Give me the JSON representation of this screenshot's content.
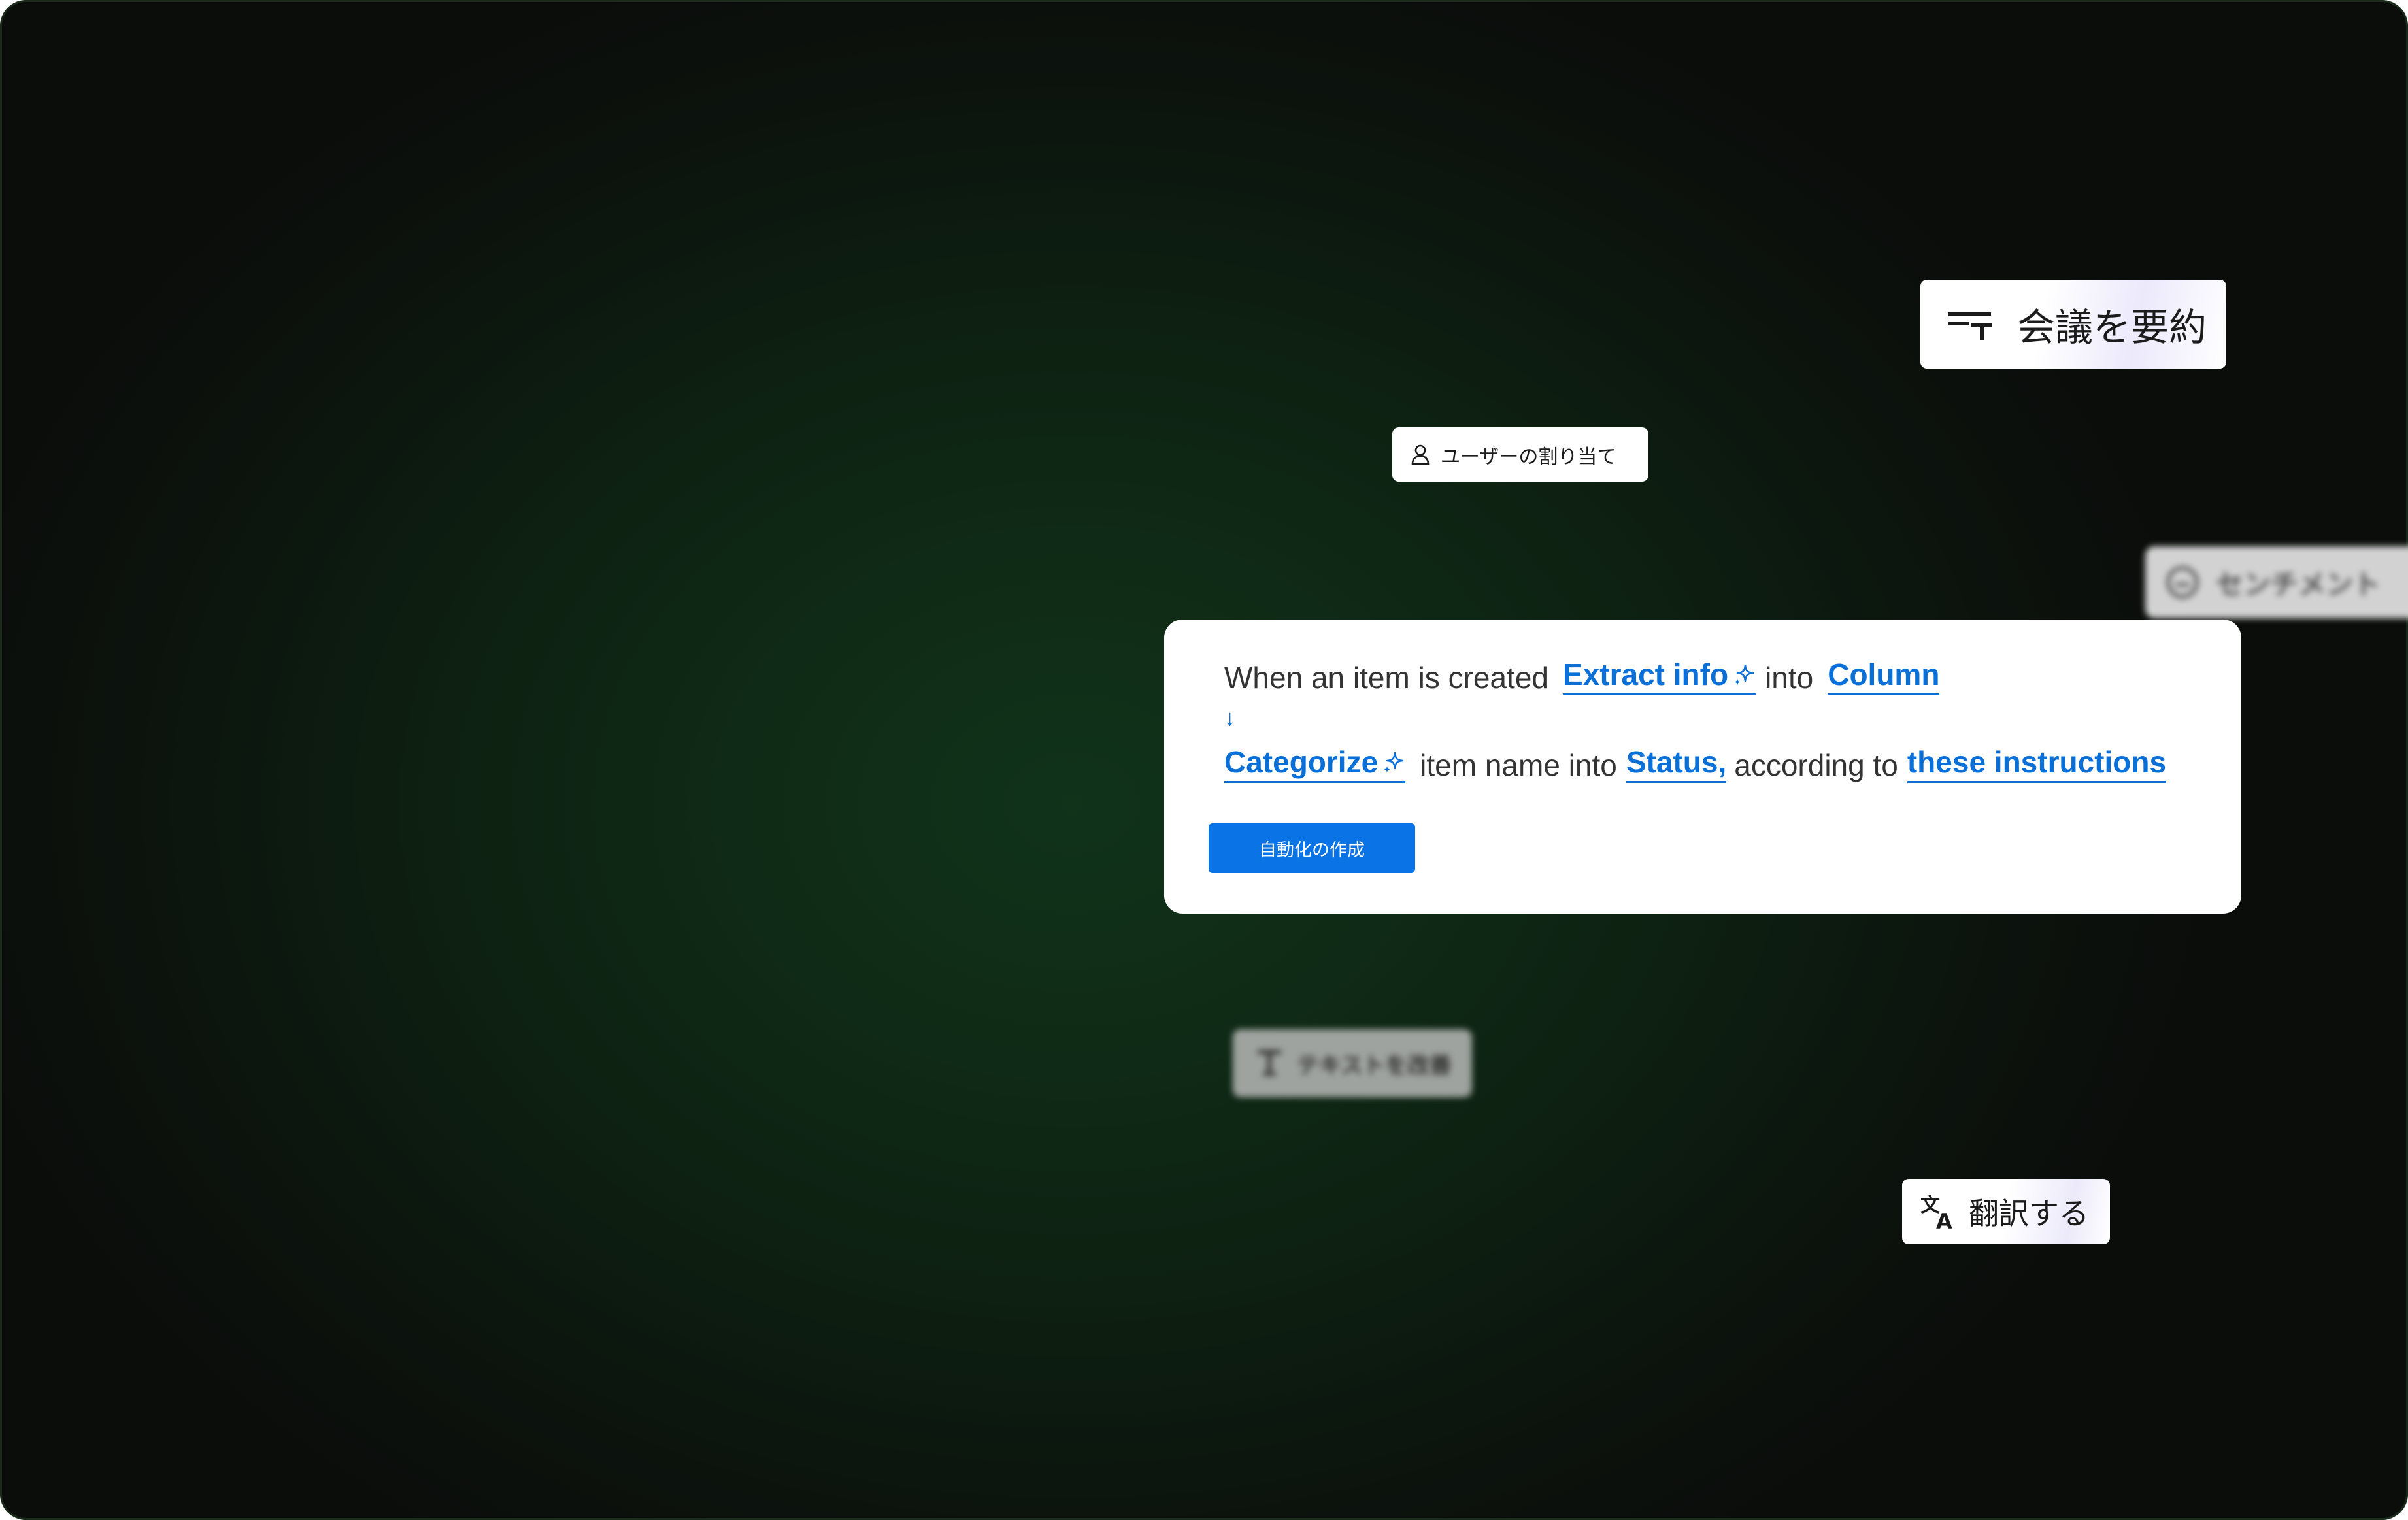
{
  "chips": {
    "summarize": {
      "label": "会議を要約",
      "icon": "text-summary-icon"
    },
    "assign": {
      "label": "ユーザーの割り当て",
      "icon": "person-icon"
    },
    "sentiment": {
      "label": "センチメント",
      "icon": "smiley-icon"
    },
    "improve": {
      "label": "テキストを改善",
      "icon": "text-t-icon"
    },
    "translate": {
      "label": "翻訳する",
      "icon": "translate-icon"
    }
  },
  "automation": {
    "line1": {
      "prefix": "When an item is created",
      "action": "Extract info",
      "mid": "into",
      "target": "Column"
    },
    "arrow": "↓",
    "line2": {
      "action": "Categorize",
      "mid1": "item name into",
      "target": "Status,",
      "mid2": "according to",
      "link": "these instructions"
    },
    "button_label": "自動化の作成"
  },
  "colors": {
    "accent": "#0a6fd6",
    "button": "#0a73e6",
    "background": "#0f2a16"
  }
}
